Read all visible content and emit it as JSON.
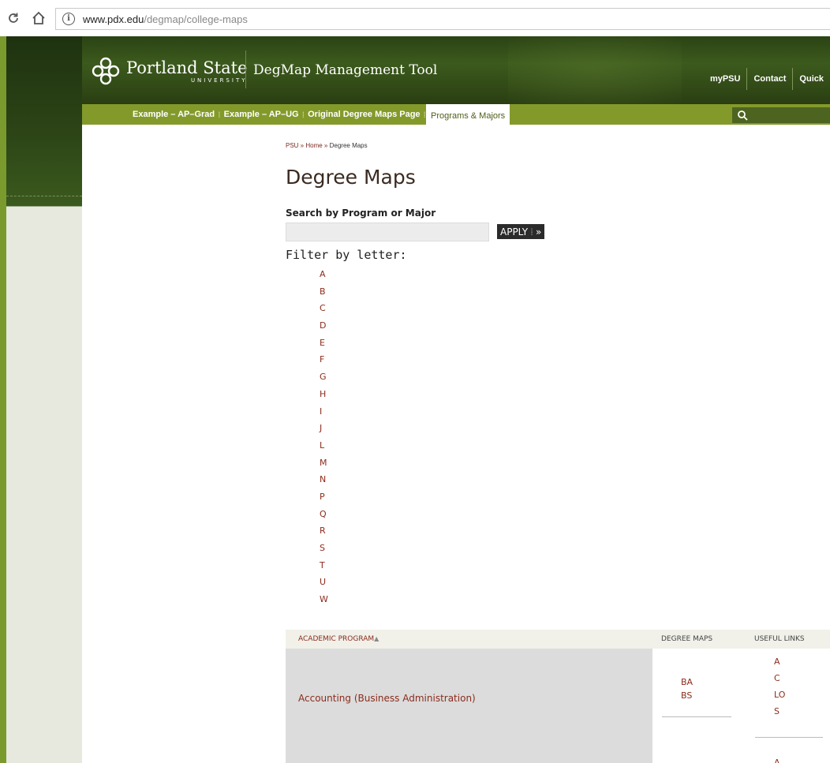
{
  "browser": {
    "url_host": "www.pdx.edu",
    "url_path": "/degmap/college-maps"
  },
  "header": {
    "logo_name": "Portland State",
    "logo_sub": "UNIVERSITY",
    "tool_title": "DegMap Management Tool",
    "util_links": [
      "myPSU",
      "Contact",
      "Quick"
    ]
  },
  "nav": {
    "items": [
      "Example – AP–Grad",
      "Example – AP–UG",
      "Original Degree Maps Page"
    ],
    "active": "Programs & Majors"
  },
  "breadcrumb": {
    "psu": "PSU",
    "sep": " » ",
    "home": "Home",
    "current": "Degree Maps"
  },
  "page": {
    "title": "Degree Maps",
    "search_label": "Search by Program or Major",
    "search_value": "",
    "apply_label": "APPLY",
    "apply_arrow": "»",
    "filter_label": "Filter by letter:"
  },
  "letters": [
    "A",
    "B",
    "C",
    "D",
    "E",
    "F",
    "G",
    "H",
    "I",
    "J",
    "L",
    "M",
    "N",
    "P",
    "Q",
    "R",
    "S",
    "T",
    "U",
    "W"
  ],
  "table": {
    "headers": {
      "program": "ACADEMIC PROGRAM",
      "maps": "DEGREE MAPS",
      "links": "USEFUL LINKS"
    },
    "rows": [
      {
        "program": "Accounting (Business Administration)",
        "maps": [
          "BA",
          "BS"
        ],
        "links": [
          "A",
          "C",
          "LO",
          "S"
        ]
      }
    ],
    "next_row_link": "A"
  },
  "colors": {
    "link": "#8b2c1c",
    "nav_green": "#839a2b",
    "header_green": "#2b4314"
  }
}
